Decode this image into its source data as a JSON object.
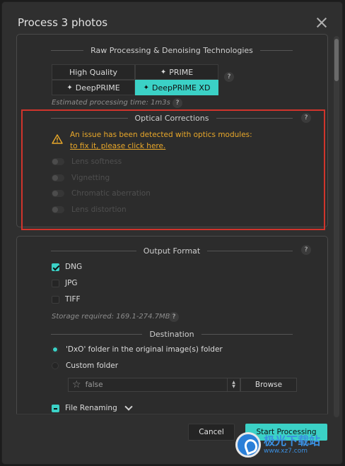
{
  "dialog": {
    "title": "Process 3 photos"
  },
  "raw": {
    "heading": "Raw Processing & Denoising Technologies",
    "options": [
      "High Quality",
      "PRIME",
      "DeepPRIME",
      "DeepPRIME XD"
    ],
    "selected": "DeepPRIME XD",
    "estimate": "Estimated processing time:  1m3s",
    "help": "?"
  },
  "optical": {
    "heading": "Optical Corrections",
    "help": "?",
    "warning_line1": "An issue has been detected with optics modules:",
    "warning_link": "to fix it, please click here.",
    "toggles": [
      "Lens softness",
      "Vignetting",
      "Chromatic aberration",
      "Lens distortion"
    ]
  },
  "output": {
    "heading": "Output Format",
    "help": "?",
    "formats": [
      {
        "label": "DNG",
        "checked": true
      },
      {
        "label": "JPG",
        "checked": false
      },
      {
        "label": "TIFF",
        "checked": false
      }
    ],
    "storage": "Storage required: 169.1-274.7MB"
  },
  "destination": {
    "heading": "Destination",
    "option1": "'DxO' folder in the original image(s) folder",
    "option2": "Custom folder",
    "folder_value": "false",
    "browse_label": "Browse"
  },
  "renaming": {
    "label": "File Renaming"
  },
  "footer": {
    "cancel": "Cancel",
    "start": "Start Processing"
  },
  "watermark": {
    "main": "极光下载站",
    "sub": "www.xz7.com"
  },
  "colors": {
    "accent": "#3bd1c6",
    "warning": "#e9a82a",
    "highlight_box": "#d0342c"
  }
}
